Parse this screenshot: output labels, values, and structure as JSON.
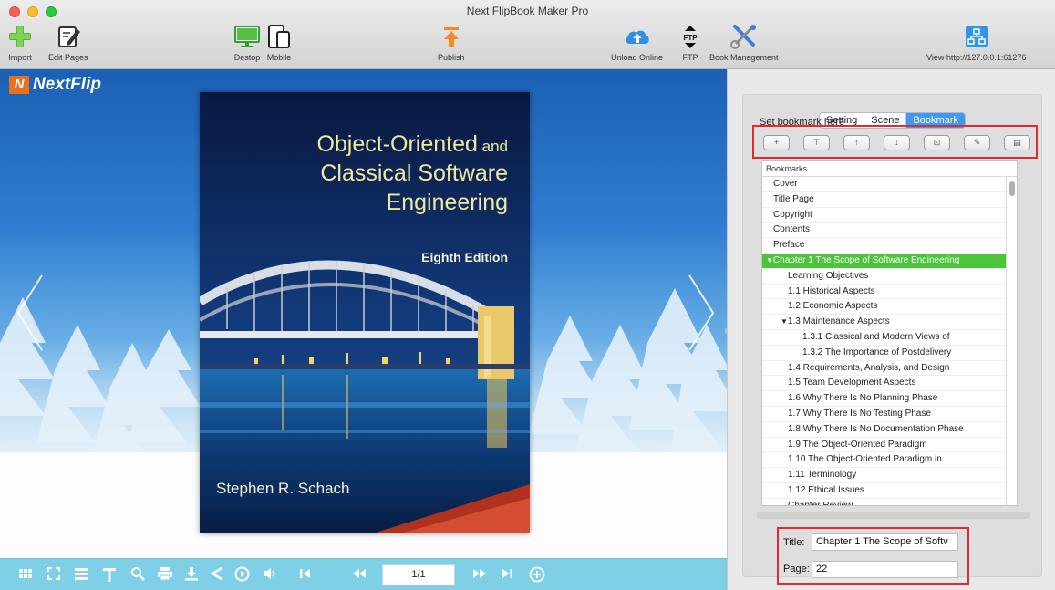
{
  "window": {
    "title": "Next FlipBook Maker Pro"
  },
  "toolbar": {
    "import": "Import",
    "edit_pages": "Edit Pages",
    "desktop": "Destop",
    "mobile": "Mobile",
    "publish": "Publish",
    "upload_online": "Unload Online",
    "ftp": "FTP",
    "ftp_icon_text": "FTP",
    "book_management": "Book Management",
    "view": "View http://127.0.0.1:61276"
  },
  "preview": {
    "brand_mark": "N",
    "brand": "NextFlip",
    "book": {
      "title_line1": "Object-Oriented",
      "title_line1_suffix": " and",
      "title_line2": "Classical Software",
      "title_line3": "Engineering",
      "edition": "Eighth Edition",
      "author": "Stephen R. Schach"
    },
    "page_indicator": "1/1"
  },
  "panel": {
    "tabs": [
      {
        "label": "Setting",
        "active": false
      },
      {
        "label": "Scene",
        "active": false
      },
      {
        "label": "Bookmark",
        "active": true
      }
    ],
    "hint": "Set bookmark here",
    "buttons": [
      {
        "name": "add",
        "glyph": "+"
      },
      {
        "name": "add-sub",
        "glyph": "⊤"
      },
      {
        "name": "move-up",
        "glyph": "↑"
      },
      {
        "name": "move-down",
        "glyph": "↓"
      },
      {
        "name": "import",
        "glyph": "⊡"
      },
      {
        "name": "edit",
        "glyph": "✎"
      },
      {
        "name": "delete",
        "glyph": "▤"
      }
    ],
    "bookmarks_header": "Bookmarks",
    "bookmarks": [
      {
        "label": "Cover",
        "level": 0,
        "toggle": ""
      },
      {
        "label": "Title Page",
        "level": 0,
        "toggle": ""
      },
      {
        "label": "Copyright",
        "level": 0,
        "toggle": ""
      },
      {
        "label": "Contents",
        "level": 0,
        "toggle": ""
      },
      {
        "label": "Preface",
        "level": 0,
        "toggle": ""
      },
      {
        "label": "Chapter 1 The Scope of Software Engineering",
        "level": 0,
        "toggle": "▼",
        "selected": true
      },
      {
        "label": "Learning Objectives",
        "level": 1,
        "toggle": ""
      },
      {
        "label": "1.1 Historical Aspects",
        "level": 1,
        "toggle": ""
      },
      {
        "label": "1.2 Economic Aspects",
        "level": 1,
        "toggle": ""
      },
      {
        "label": "1.3 Maintenance Aspects",
        "level": 1,
        "toggle": "▼"
      },
      {
        "label": "1.3.1 Classical and Modern Views of",
        "level": 2,
        "toggle": ""
      },
      {
        "label": "1.3.2 The Importance of Postdelivery",
        "level": 2,
        "toggle": ""
      },
      {
        "label": "1.4 Requirements, Analysis, and Design",
        "level": 1,
        "toggle": ""
      },
      {
        "label": "1.5 Team Development Aspects",
        "level": 1,
        "toggle": ""
      },
      {
        "label": "1.6 Why There Is No Planning Phase",
        "level": 1,
        "toggle": ""
      },
      {
        "label": "1.7 Why There Is No Testing Phase",
        "level": 1,
        "toggle": ""
      },
      {
        "label": "1.8 Why There Is No Documentation Phase",
        "level": 1,
        "toggle": ""
      },
      {
        "label": "1.9 The Object-Oriented Paradigm",
        "level": 1,
        "toggle": ""
      },
      {
        "label": "1.10 The Object-Oriented Paradigm in",
        "level": 1,
        "toggle": ""
      },
      {
        "label": "1.11 Terminology",
        "level": 1,
        "toggle": ""
      },
      {
        "label": "1.12 Ethical Issues",
        "level": 1,
        "toggle": ""
      },
      {
        "label": "Chapter Review",
        "level": 1,
        "toggle": ""
      }
    ],
    "title_label": "Title:",
    "title_value": "Chapter 1 The Scope of Softv",
    "page_label": "Page:",
    "page_value": "22"
  },
  "colors": {
    "accent": "#3f98f4",
    "selected_row": "#4cc43b",
    "highlight_box": "#e32b2b",
    "bottom_bar": "#7fd0e7"
  }
}
